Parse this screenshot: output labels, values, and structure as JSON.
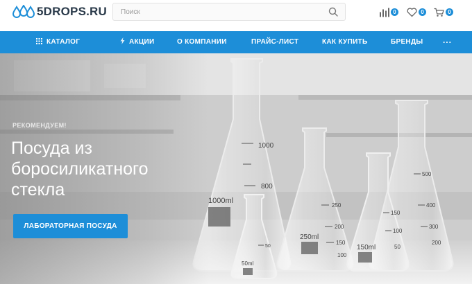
{
  "header": {
    "logo_text": "5DROPS.RU",
    "search": {
      "placeholder": "Поиск",
      "value": ""
    },
    "compare_count": "0",
    "wishlist_count": "0",
    "cart_count": "0"
  },
  "nav": {
    "items": [
      {
        "label": "КАТАЛОГ",
        "icon": "grid-icon"
      },
      {
        "label": "АКЦИИ",
        "icon": "lightning-icon"
      },
      {
        "label": "О КОМПАНИИ"
      },
      {
        "label": "ПРАЙС-ЛИСТ"
      },
      {
        "label": "КАК КУПИТЬ"
      },
      {
        "label": "БРЕНДЫ"
      },
      {
        "label": "···"
      }
    ]
  },
  "hero": {
    "eyebrow": "РЕКОМЕНДУЕМ!",
    "title": "Посуда из боросиликатного стекла",
    "button": "ЛАБОРАТОРНАЯ ПОСУДА",
    "flask_marks": {
      "big": [
        "1000",
        "800",
        "1000ml"
      ],
      "mid": [
        "250",
        "200",
        "150",
        "100",
        "250ml"
      ],
      "right": [
        "500",
        "400",
        "300",
        "200"
      ],
      "small150": [
        "150",
        "100",
        "50",
        "150ml"
      ],
      "small50": [
        "50ml",
        "50"
      ]
    }
  },
  "colors": {
    "accent": "#1d8ed8",
    "nav_text": "#ffffff",
    "logo_text": "#2a3a4a"
  }
}
